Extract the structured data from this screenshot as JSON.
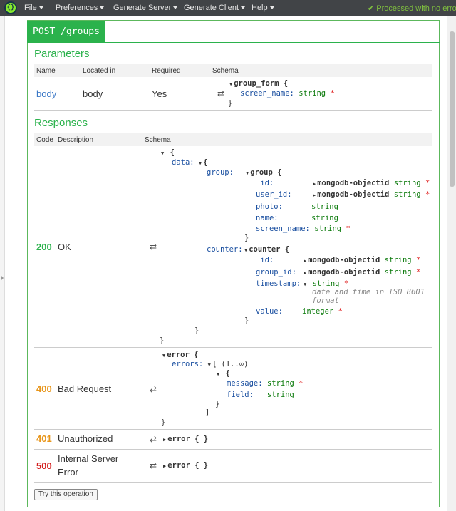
{
  "menubar": {
    "logo": "{}",
    "items": [
      "File",
      "Preferences",
      "Generate Server",
      "Generate Client",
      "Help"
    ],
    "status": "Processed with no error",
    "status_icon": "check-icon"
  },
  "operation": {
    "badge": "POST /groups",
    "parameters_title": "Parameters",
    "param_headers": [
      "Name",
      "Located in",
      "Required",
      "Schema"
    ],
    "param": {
      "name": "body",
      "located_in": "body",
      "required": "Yes",
      "schema": {
        "root": "group_form {",
        "field_key": "screen_name:",
        "field_type": "string",
        "field_req": "*",
        "close": "}"
      }
    },
    "responses_title": "Responses",
    "resp_headers": [
      "Code",
      "Description",
      "Schema"
    ],
    "ok": {
      "code": "200",
      "description": "OK",
      "open": "{",
      "data_key": "data:",
      "data_open": "{",
      "group_key": "group:",
      "group_name": "group {",
      "group_fields": [
        {
          "key": "_id:",
          "ref": "mongodb-objectid",
          "type": "string",
          "req": "*"
        },
        {
          "key": "user_id:",
          "ref": "mongodb-objectid",
          "type": "string",
          "req": "*"
        },
        {
          "key": "photo:",
          "ref": "",
          "type": "string",
          "req": ""
        },
        {
          "key": "name:",
          "ref": "",
          "type": "string",
          "req": ""
        },
        {
          "key": "screen_name:",
          "ref": "",
          "type": "string",
          "req": "*"
        }
      ],
      "group_close": "}",
      "counter_key": "counter:",
      "counter_name": "counter {",
      "counter_fields": [
        {
          "key": "_id:",
          "ref": "mongodb-objectid",
          "type": "string",
          "req": "*"
        },
        {
          "key": "group_id:",
          "ref": "mongodb-objectid",
          "type": "string",
          "req": "*"
        },
        {
          "key": "timestamp:",
          "ref": "",
          "type": "string",
          "req": "*"
        },
        {
          "key": "value:",
          "ref": "",
          "type": "integer",
          "req": "*"
        }
      ],
      "timestamp_format_1": "date and time in ISO 8601",
      "timestamp_format_2": "format",
      "counter_close": "}",
      "data_close": "}",
      "close": "}"
    },
    "bad_request": {
      "code": "400",
      "description": "Bad Request",
      "root": "error {",
      "errors_key": "errors:",
      "errors_open": "[",
      "errors_range": "(1..∞)",
      "item_open": "{",
      "message_key": "message:",
      "message_type": "string",
      "message_req": "*",
      "field_key": "field:",
      "field_type": "string",
      "item_close": "}",
      "errors_close": "]",
      "close": "}"
    },
    "unauthorized": {
      "code": "401",
      "description": "Unauthorized",
      "schema": "error { }"
    },
    "server_error": {
      "code": "500",
      "description_1": "Internal Server",
      "description_2": "Error",
      "schema": "error { }"
    },
    "try_button": "Try this operation",
    "colors": {
      "green": "#2bb24c",
      "orange": "#e8961b",
      "red": "#d41f1f"
    }
  }
}
